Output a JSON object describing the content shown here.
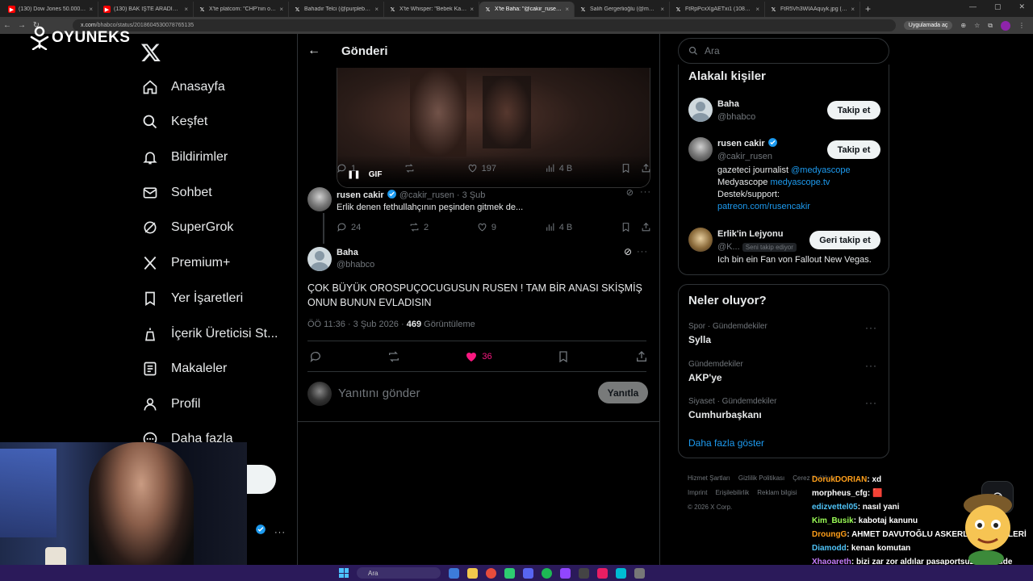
{
  "browser": {
    "tabs": [
      {
        "title": "(130) Dow Jones 50.000 Oldu !",
        "fav": "yt",
        "active": false
      },
      {
        "title": "(130) BAK İŞTE ARADIĞIM OYU",
        "fav": "yt",
        "active": false
      },
      {
        "title": "X'te platcom: \"CHP'nin oyunlar",
        "fav": "x",
        "active": false
      },
      {
        "title": "Bahadır Telci (@purplebix) / X",
        "fav": "x",
        "active": false
      },
      {
        "title": "X'te Whisper: \"Bebek Katili Abd",
        "fav": "x",
        "active": false
      },
      {
        "title": "X'te Baha: \"@cakir_rusen @Ka",
        "fav": "x",
        "active": true
      },
      {
        "title": "Salih Gergerlioğlu (@msalihgr",
        "fav": "x",
        "active": false
      },
      {
        "title": "FtRpPcxXgAETxi1 (1080×807)",
        "fav": "x",
        "active": false
      },
      {
        "title": "FtR5Vh3WIAAquyk.jpg (864×1",
        "fav": "x",
        "active": false
      }
    ],
    "url_host": "x.com",
    "url_path": "/bhabco/status/2018604530078765135",
    "app_pill": "Uygulamada aç"
  },
  "overlay": {
    "logo_text": "OYUNEKS"
  },
  "sidebar": {
    "items": [
      {
        "label": "Anasayfa",
        "icon": "home-icon"
      },
      {
        "label": "Keşfet",
        "icon": "search-icon"
      },
      {
        "label": "Bildirimler",
        "icon": "bell-icon"
      },
      {
        "label": "Sohbet",
        "icon": "mail-icon"
      },
      {
        "label": "SuperGrok",
        "icon": "grok-icon"
      },
      {
        "label": "Premium+",
        "icon": "x-icon"
      },
      {
        "label": "Yer İşaretleri",
        "icon": "bookmark-icon"
      },
      {
        "label": "İçerik Üreticisi St...",
        "icon": "creator-icon"
      },
      {
        "label": "Makaleler",
        "icon": "article-icon"
      },
      {
        "label": "Profil",
        "icon": "profile-icon"
      },
      {
        "label": "Daha fazla",
        "icon": "more-icon"
      }
    ]
  },
  "main": {
    "header_title": "Gönderi",
    "gif_label": "GIF",
    "parent_actions": {
      "replies": "1",
      "reposts": "",
      "likes": "197",
      "views": "4 B"
    },
    "reply": {
      "name": "rusen cakir",
      "handle": "@cakir_rusen",
      "time": "· 3 Şub",
      "text": "Erlik denen fethullahçının peşinden gitmek de...",
      "replies": "24",
      "reposts": "2",
      "likes": "9",
      "views": "4 B"
    },
    "tweet": {
      "name": "Baha",
      "handle": "@bhabco",
      "text": "ÇOK BÜYÜK OROSPUÇOCUGUSUN RUSEN ! TAM BİR ANASI SKİŞMİŞ ONUN BUNUN EVLADISIN",
      "timestamp": "ÖÖ 11:36 · 3 Şub 2026 ·",
      "views_count": "469",
      "views_label": "Görüntüleme",
      "likes": "36"
    },
    "reply_placeholder": "Yanıtını gönder",
    "reply_button": "Yanıtla"
  },
  "right": {
    "search_placeholder": "Ara",
    "related_title": "Alakalı kişiler",
    "people": [
      {
        "name": "Baha",
        "handle": "@bhabco",
        "button": "Takip et"
      },
      {
        "name": "rusen cakir",
        "handle": "@cakir_rusen",
        "button": "Takip et",
        "bio1_pre": "gazeteci journalist ",
        "bio1_link": "@medyascope",
        "bio2_pre": "Medyascope ",
        "bio2_link": "medyascope.tv",
        "bio3": "Destek/support:",
        "bio4_link": "patreon.com/rusencakir"
      },
      {
        "name": "Erlik'in Lejyonu",
        "handle": "@K...",
        "follows_you": "Seni takip ediyor",
        "button": "Geri takip et",
        "bio1_pre": "Ich bin ein Fan von Fallout New Vegas."
      }
    ],
    "trends_title": "Neler oluyor?",
    "trends": [
      {
        "category": "Spor · Gündemdekiler",
        "name": "Sylla"
      },
      {
        "category": "Gündemdekiler",
        "name": "AKP'ye"
      },
      {
        "category": "Siyaset · Gündemdekiler",
        "name": "Cumhurbaşkanı"
      }
    ],
    "show_more": "Daha fazla göster",
    "footer": {
      "links1": [
        "Hizmet Şartları",
        "Gizlilik Politikası",
        "Çerez Politikası"
      ],
      "links2": [
        "Imprint",
        "Erişilebilirlik",
        "Reklam bilgisi"
      ],
      "copyright": "© 2026 X Corp."
    }
  },
  "chat": [
    {
      "user": "DorukDORIAN",
      "color": "#ff9f1a",
      "msg": ": xd"
    },
    {
      "user": "morpheus_cfg",
      "color": "#ffffff",
      "msg": ": 🟥"
    },
    {
      "user": "edizvettel05",
      "color": "#4fc3f7",
      "msg": ": nasıl yani"
    },
    {
      "user": "Kim_Busik",
      "color": "#9cff57",
      "msg": ": kabotaj kanunu"
    },
    {
      "user": "DroungG",
      "color": "#ff9f1a",
      "msg": ": AHMET DAVUTOĞLU ASKERLİK HİKAYELERİ"
    },
    {
      "user": "Diamodd",
      "color": "#4fc3f7",
      "msg": ": kenan komutan"
    },
    {
      "user": "Xhaoareth",
      "color": "#c77dff",
      "msg": ": bizi zar zor aldılar pasaportsuz normalde yasaktı"
    }
  ],
  "taskbar": {
    "search_placeholder": "Ara"
  },
  "colors": {
    "accent": "#1d9bf0",
    "like": "#f91880",
    "background": "#000000",
    "border": "#2f3336"
  }
}
